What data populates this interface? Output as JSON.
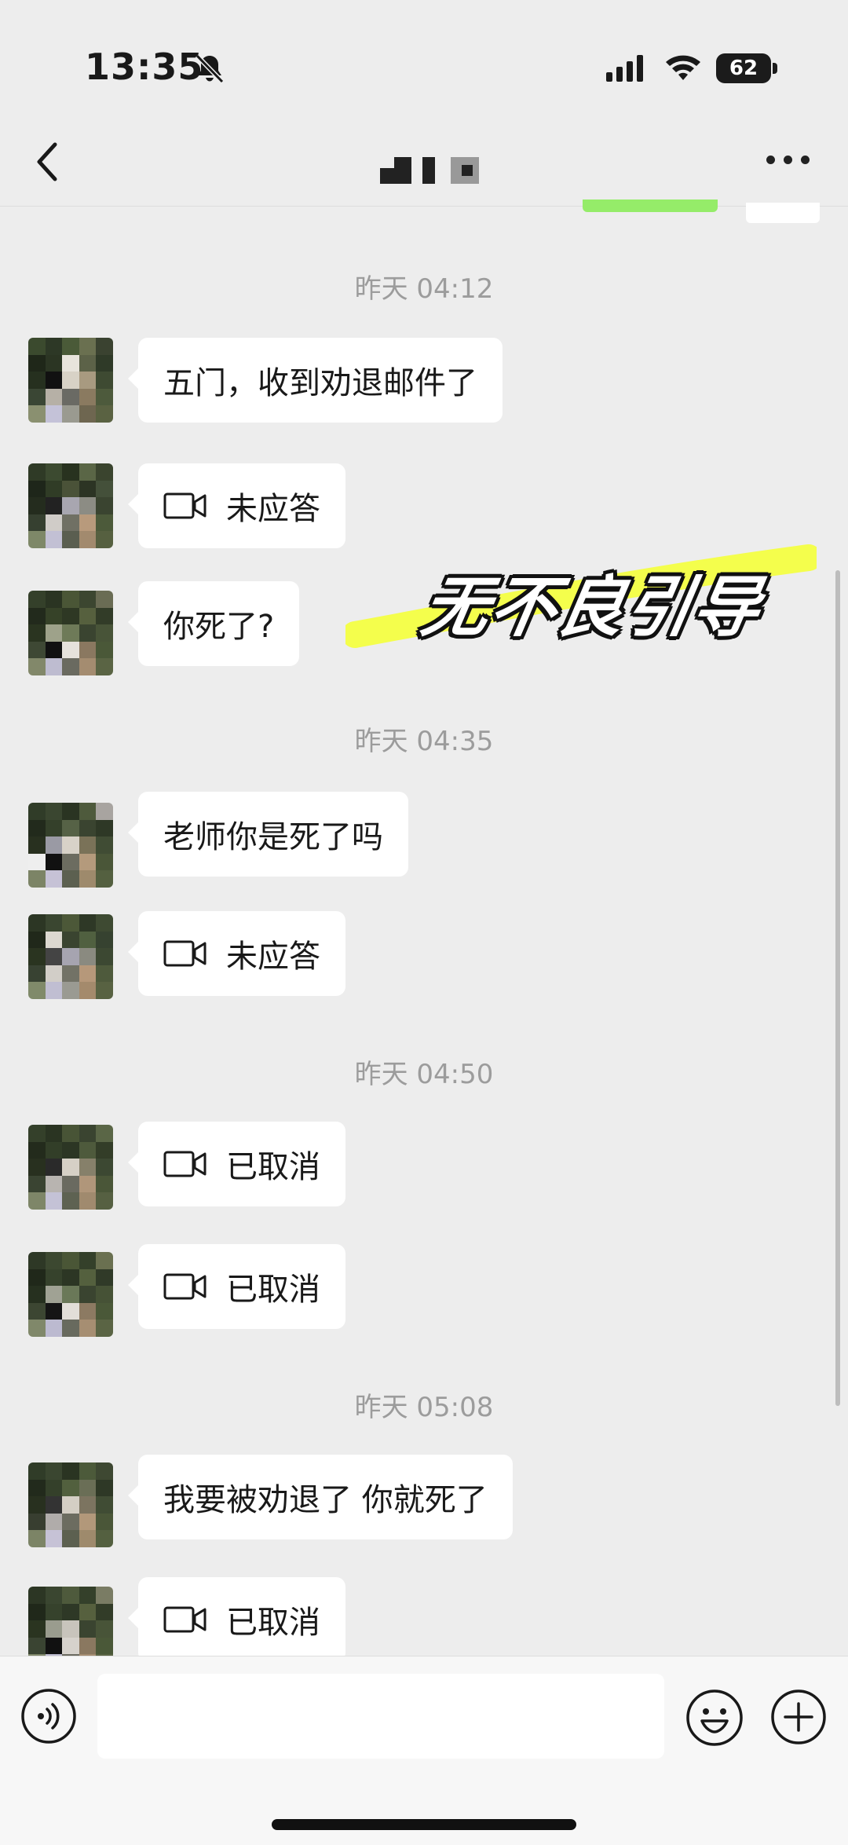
{
  "status_bar": {
    "time": "13:35",
    "battery": "62"
  },
  "header": {
    "back_icon": "chevron-left-icon",
    "title_icon": "redacted-name",
    "more_icon": "more-horizontal-icon"
  },
  "watermark": "无不良引导",
  "messages": [
    {
      "type": "time",
      "text": "昨天 04:12"
    },
    {
      "type": "text",
      "text": "五门，收到劝退邮件了"
    },
    {
      "type": "call",
      "text": "未应答",
      "icon": "video-call-icon"
    },
    {
      "type": "text",
      "text": "你死了?"
    },
    {
      "type": "time",
      "text": "昨天 04:35"
    },
    {
      "type": "text",
      "text": "老师你是死了吗"
    },
    {
      "type": "call",
      "text": "未应答",
      "icon": "video-call-icon"
    },
    {
      "type": "time",
      "text": "昨天 04:50"
    },
    {
      "type": "call",
      "text": "已取消",
      "icon": "video-call-icon"
    },
    {
      "type": "call",
      "text": "已取消",
      "icon": "video-call-icon"
    },
    {
      "type": "time",
      "text": "昨天 05:08"
    },
    {
      "type": "text",
      "text": "我要被劝退了 你就死了"
    },
    {
      "type": "call",
      "text": "已取消",
      "icon": "video-call-icon"
    }
  ],
  "input_bar": {
    "voice_icon": "voice-icon",
    "input_value": "",
    "emoji_icon": "emoji-icon",
    "plus_icon": "plus-icon"
  },
  "colors": {
    "background": "#ededed",
    "bubble": "#ffffff",
    "self_bubble": "#95ec69",
    "timestamp": "#9c9c9c",
    "highlight": "#f4ff3a"
  }
}
